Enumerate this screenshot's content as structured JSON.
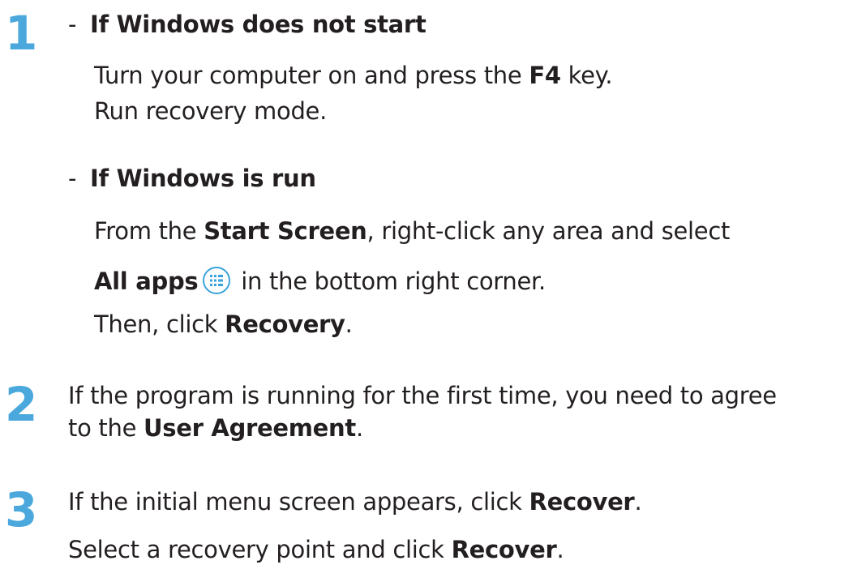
{
  "step1": {
    "number": "1",
    "branch_a": {
      "dash": "-",
      "heading": "If Windows does not start",
      "line1_pre": "Turn your computer on and press the ",
      "line1_key": "F4",
      "line1_post": " key.",
      "line2": "Run recovery mode."
    },
    "branch_b": {
      "dash": "-",
      "heading": "If Windows is run",
      "line1_pre": "From the ",
      "line1_bold": "Start Screen",
      "line1_post": ", right-click any area and select",
      "line2_bold": "All apps",
      "line2_icon": "all-apps-icon",
      "line2_post": " in the bottom right corner.",
      "line3_pre": "Then, click ",
      "line3_bold": "Recovery",
      "line3_post": "."
    }
  },
  "step2": {
    "number": "2",
    "line1": "If the program is running for the first time, you need to agree",
    "line2_pre": "to the ",
    "line2_bold": "User Agreement",
    "line2_post": "."
  },
  "step3": {
    "number": "3",
    "line1_pre": "If the initial menu screen appears, click ",
    "line1_bold": "Recover",
    "line1_post": ".",
    "line2_pre": "Select a recovery point and click ",
    "line2_bold": "Recover",
    "line2_post": "."
  },
  "colors": {
    "step_number": "#4aa8dd",
    "text": "#231f20",
    "icon": "#3aa3dc"
  }
}
